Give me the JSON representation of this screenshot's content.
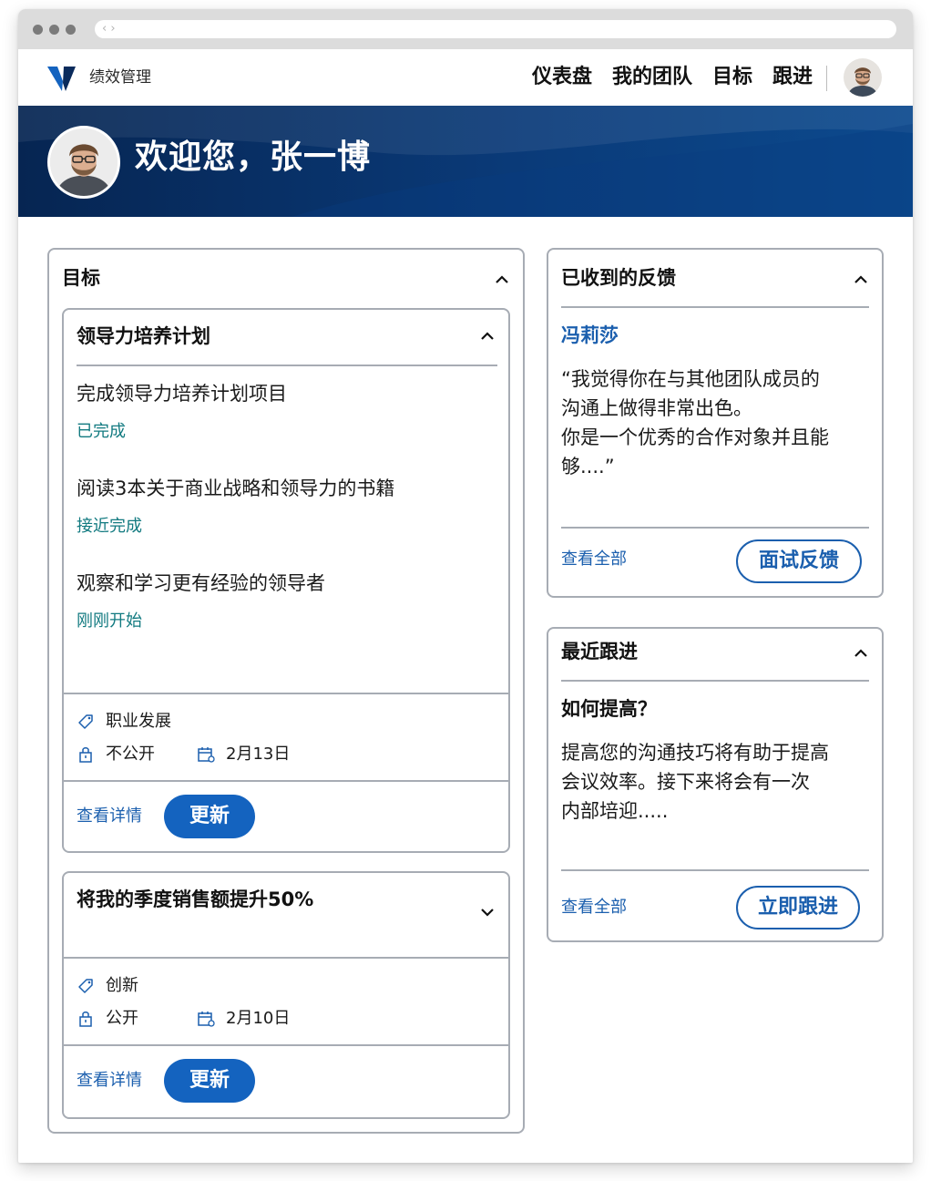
{
  "app": {
    "name": "绩效管理"
  },
  "nav": {
    "items": [
      "仪表盘",
      "我的团队",
      "目标",
      "跟进"
    ]
  },
  "hero": {
    "greeting": "欢迎您，张一博"
  },
  "goals_panel": {
    "title": "目标",
    "goals": [
      {
        "title": "领导力培养计划",
        "tasks": [
          {
            "text": "完成领导力培养计划项目",
            "status": "已完成"
          },
          {
            "text": "阅读3本关于商业战略和领导力的书籍",
            "status": "接近完成"
          },
          {
            "text": "观察和学习更有经验的领导者",
            "status": "刚刚开始"
          }
        ],
        "category": "职业发展",
        "visibility": "不公开",
        "date": "2月13日",
        "details_link": "查看详情",
        "update_button": "更新"
      },
      {
        "title": "将我的季度销售额提升50%",
        "category": "创新",
        "visibility": "公开",
        "date": "2月10日",
        "details_link": "查看详情",
        "update_button": "更新"
      }
    ]
  },
  "feedback_panel": {
    "title": "已收到的反馈",
    "sender": "冯莉莎",
    "text": "“我觉得你在与其他团队成员的\n沟通上做得非常出色。\n你是一个优秀的合作对象并且能\n够....”",
    "view_all": "查看全部",
    "button": "面试反馈"
  },
  "followup_panel": {
    "title": "最近跟进",
    "question": "如何提高？",
    "text": "提高您的沟通技巧将有助于提高\n会议效率。接下来将会有一次\n内部培迎.....",
    "view_all": "查看全部",
    "button": "立即跟进"
  },
  "colors": {
    "brand": "#1463bf",
    "hero_dark": "#062552",
    "status_teal": "#127a80",
    "border": "#a7acb4"
  },
  "icons": [
    "chevron-up-icon",
    "chevron-down-icon",
    "tag-icon",
    "lock-icon",
    "calendar-icon",
    "logo-icon",
    "avatar"
  ]
}
